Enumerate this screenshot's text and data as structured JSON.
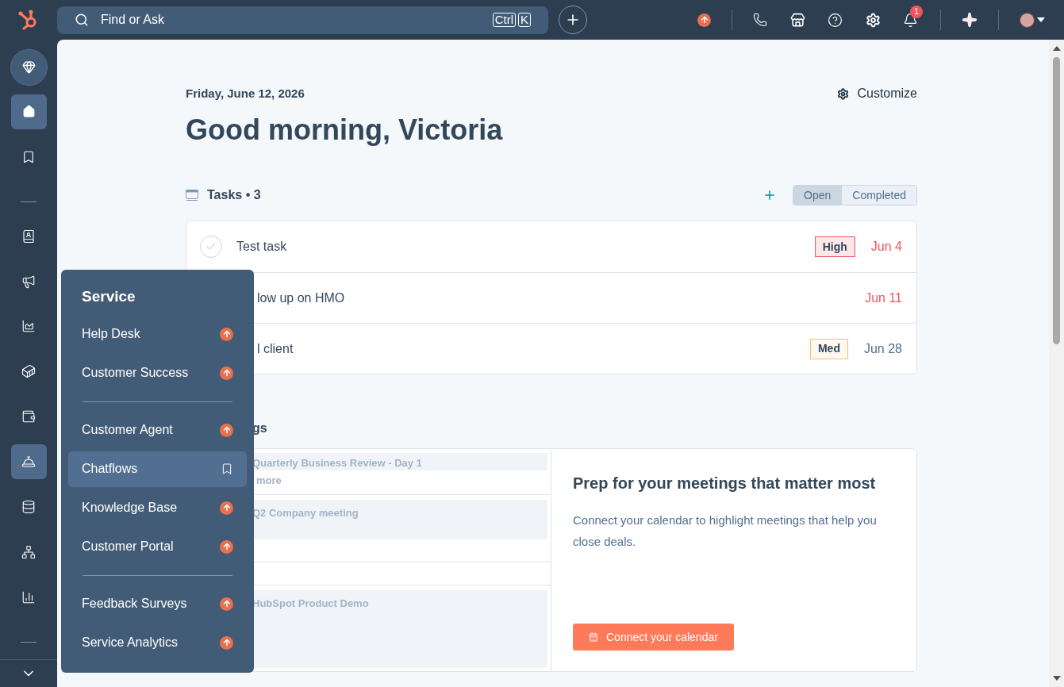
{
  "topbar": {
    "search": {
      "placeholder": "Find or Ask",
      "keys": [
        "Ctrl",
        "K"
      ]
    },
    "notifications": {
      "badge": "1"
    }
  },
  "sidebar": {
    "items": [
      {
        "selected": false
      },
      {
        "selected": true
      },
      {
        "selected": false
      },
      {
        "selected": false
      },
      {
        "selected": false
      },
      {
        "selected": false
      },
      {
        "selected": false
      },
      {
        "selected": false
      },
      {
        "selected": true
      },
      {
        "selected": false
      },
      {
        "selected": false
      },
      {
        "selected": false
      }
    ]
  },
  "header": {
    "date": "Friday, June 12, 2026",
    "greeting": "Good morning, Victoria",
    "customize": "Customize"
  },
  "tasks": {
    "title": "Tasks • 3",
    "filters": [
      {
        "label": "Open",
        "selected": true
      },
      {
        "label": "Completed",
        "selected": false
      }
    ],
    "rows": [
      {
        "checked": false,
        "title": "Test task",
        "priority": {
          "kind": "high",
          "label": "High"
        },
        "due": "Jun 4",
        "overdue": true
      },
      {
        "title": "low up on HMO",
        "due": "Jun 11",
        "overdue": true
      },
      {
        "title": "l client",
        "priority": {
          "kind": "med",
          "label": "Med"
        },
        "due": "Jun 28",
        "overdue": false
      }
    ]
  },
  "meetings": {
    "title": "gs",
    "items": [
      {
        "title": "Quarterly Business Review - Day 1",
        "more": "more"
      },
      {
        "title": "Q2 Company meeting"
      },
      {
        "title": "HubSpot Product Demo"
      }
    ],
    "prompt": {
      "title": "Prep for your meetings that matter most",
      "text": "Connect your calendar to highlight meetings that help you close deals.",
      "button": "Connect your calendar"
    }
  },
  "menu": {
    "title": "Service",
    "groups": [
      [
        {
          "label": "Help Desk",
          "kind": "upgrade",
          "selected": false
        },
        {
          "label": "Customer Success",
          "kind": "upgrade",
          "selected": false
        }
      ],
      [
        {
          "label": "Customer Agent",
          "kind": "upgrade",
          "selected": false
        },
        {
          "label": "Chatflows",
          "kind": "bookmark",
          "selected": true
        },
        {
          "label": "Knowledge Base",
          "kind": "upgrade",
          "selected": false
        },
        {
          "label": "Customer Portal",
          "kind": "upgrade",
          "selected": false
        }
      ],
      [
        {
          "label": "Feedback Surveys",
          "kind": "upgrade",
          "selected": false
        },
        {
          "label": "Service Analytics",
          "kind": "upgrade",
          "selected": false
        }
      ]
    ]
  }
}
